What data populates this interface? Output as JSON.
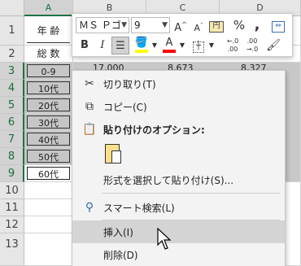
{
  "columns": [
    "A",
    "B",
    "C",
    "D"
  ],
  "rows": [
    "1",
    "2",
    "3",
    "4",
    "5",
    "6",
    "7",
    "8",
    "9",
    "10",
    "11",
    "12",
    "13"
  ],
  "cells_a": [
    "年 齢",
    "総 数",
    "0-9",
    "10代",
    "20代",
    "30代",
    "40代",
    "50代",
    "60代"
  ],
  "row3_values": [
    "17,000",
    "8,673",
    "8,327"
  ],
  "mini_toolbar": {
    "font_name": "ＭＳ Ｐゴ",
    "font_size": "9",
    "grow_font": "A^",
    "shrink_font": "A˅",
    "percent": "%",
    "comma": ",",
    "bold": "B",
    "italic": "I",
    "decimal_inc": "←.0 .00",
    "decimal_dec": ".00 →.0"
  },
  "context_menu": {
    "cut": "切り取り(T)",
    "copy": "コピー(C)",
    "paste_options_header": "貼り付けのオプション:",
    "paste_special": "形式を選択して貼り付け(S)...",
    "smart_lookup": "スマート検索(L)",
    "insert": "挿入(I)",
    "delete": "削除(D)"
  },
  "colors": {
    "accent_green": "#1e7145",
    "highlight_yellow": "#ffff00",
    "font_red": "#ff0000",
    "smart_blue": "#2b6cb0"
  }
}
